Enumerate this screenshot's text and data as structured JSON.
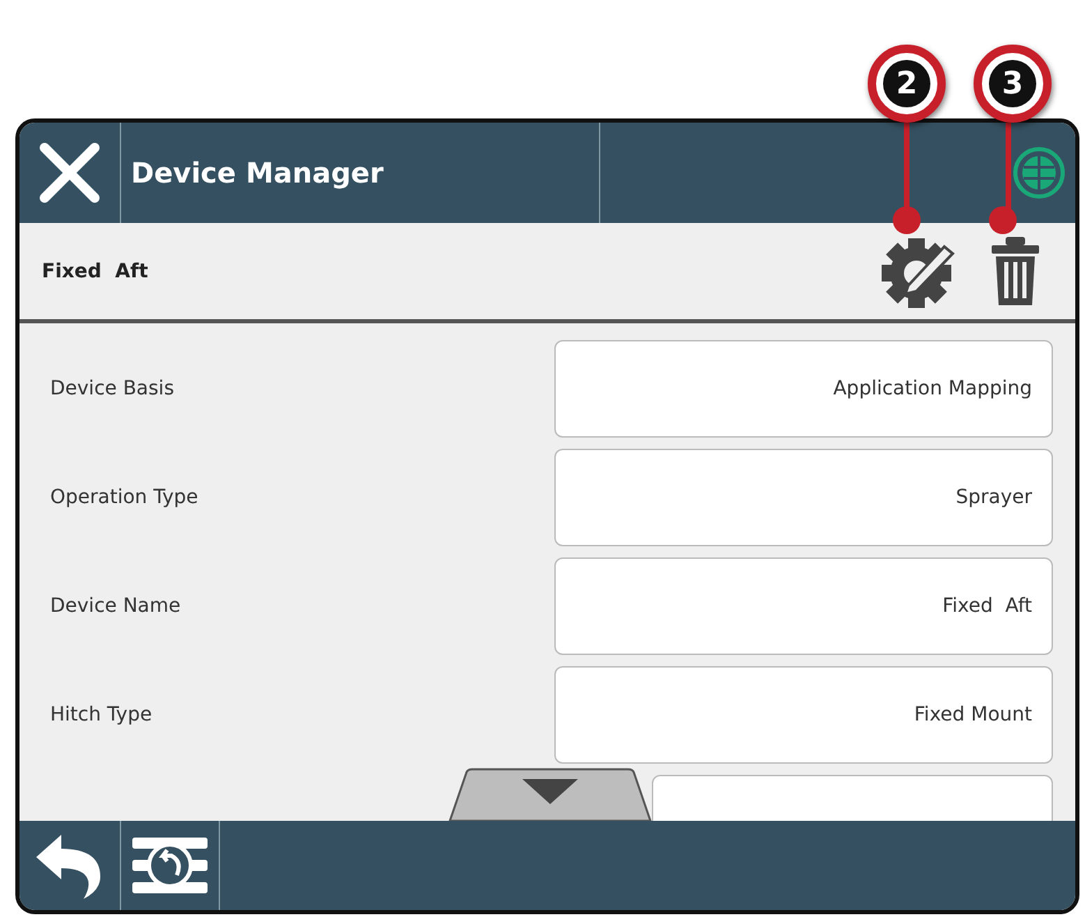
{
  "window": {
    "title": "Device Manager"
  },
  "subheader": {
    "title": "Fixed  Aft"
  },
  "callouts": [
    "2",
    "3"
  ],
  "settings": [
    {
      "label": "Device Basis",
      "value": "Application Mapping"
    },
    {
      "label": "Operation Type",
      "value": "Sprayer"
    },
    {
      "label": "Device Name",
      "value": "Fixed  Aft"
    },
    {
      "label": "Hitch Type",
      "value": "Fixed Mount"
    }
  ]
}
